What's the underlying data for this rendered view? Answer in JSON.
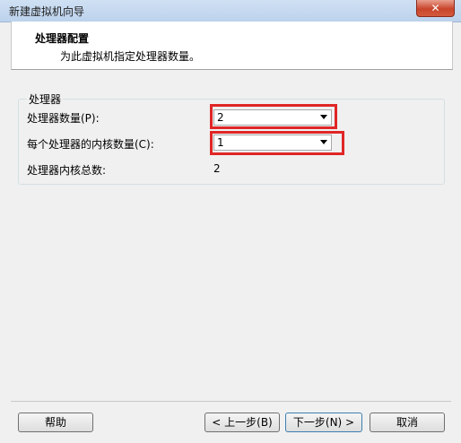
{
  "window": {
    "title": "新建虚拟机向导",
    "close_glyph": "✕"
  },
  "header": {
    "title": "处理器配置",
    "subtitle": "为此虚拟机指定处理器数量。"
  },
  "processor_group": {
    "legend": "处理器",
    "processor_count": {
      "label": "处理器数量(P):",
      "value": "2"
    },
    "cores_per_processor": {
      "label": "每个处理器的内核数量(C):",
      "value": "1"
    },
    "total_cores": {
      "label": "处理器内核总数:",
      "value": "2"
    }
  },
  "footer": {
    "help_label": "帮助",
    "back_label": "< 上一步(B)",
    "next_label": "下一步(N) >",
    "cancel_label": "取消"
  },
  "colors": {
    "highlight": "#e02626",
    "header_bg": "#ffffff",
    "dialog_bg": "#f0f0f0"
  }
}
